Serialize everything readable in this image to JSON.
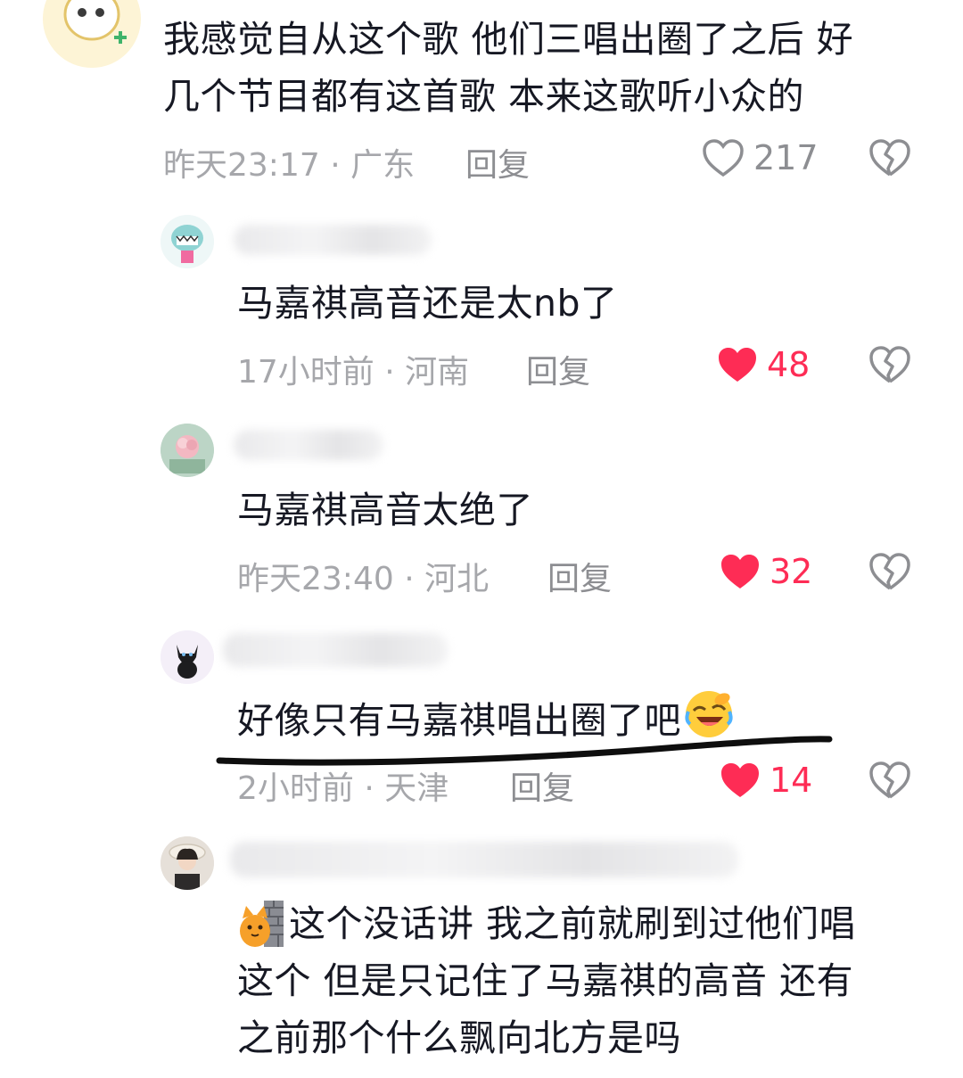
{
  "comments": [
    {
      "text_lines": [
        "我感觉自从这个歌 他们三唱出圈了之后 好",
        "几个节目都有这首歌 本来这歌听小众的"
      ],
      "meta": "昨天23:17 · 广东",
      "reply": "回复",
      "likes": "217",
      "liked": false
    },
    {
      "text": "马嘉祺高音还是太nb了",
      "meta": "17小时前 · 河南",
      "reply": "回复",
      "likes": "48",
      "liked": true
    },
    {
      "text": "马嘉祺高音太绝了",
      "meta": "昨天23:40 · 河北",
      "reply": "回复",
      "likes": "32",
      "liked": true
    },
    {
      "text": "好像只有马嘉祺唱出圈了吧",
      "emoji": "laughing-crying-emoji",
      "meta": "2小时前 · 天津",
      "reply": "回复",
      "likes": "14",
      "liked": true
    },
    {
      "sticker": "cat-behind-wall-sticker",
      "text_lines": [
        "这个没话讲 我之前就刷到过他们唱",
        "这个 但是只记住了马嘉祺的高音 还有",
        "之前那个什么飘向北方是吗"
      ]
    }
  ],
  "icons": {
    "like": "heart-icon",
    "dislike": "broken-heart-icon"
  },
  "colors": {
    "liked_red": "#fe2c55",
    "meta_grey": "#a6a7ab",
    "text": "#161823"
  }
}
